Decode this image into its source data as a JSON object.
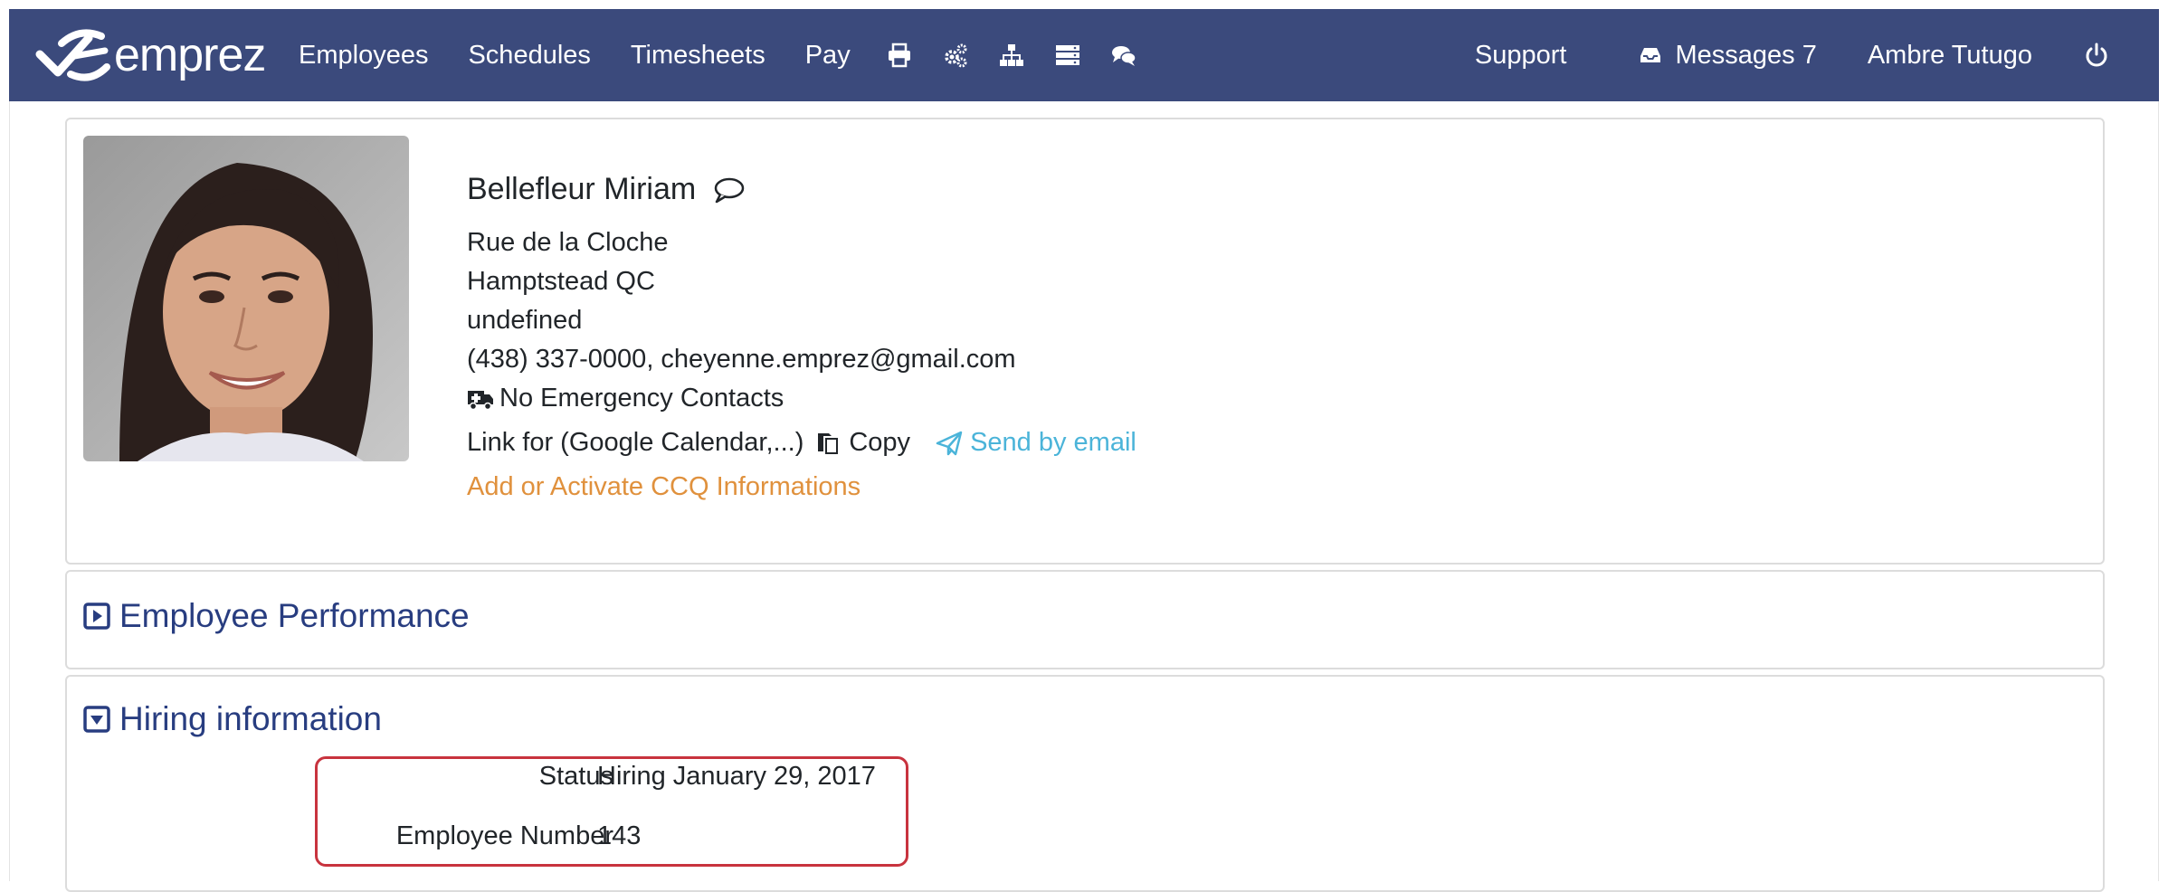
{
  "navbar": {
    "brand_name": "emprez",
    "links": [
      "Employees",
      "Schedules",
      "Timesheets",
      "Pay"
    ],
    "icons": [
      "print-icon",
      "settings-gears-icon",
      "org-chart-icon",
      "server-list-icon",
      "chat-icon"
    ],
    "support_label": "Support",
    "messages_label": "Messages 7",
    "user_name": "Ambre Tutugo",
    "bg_color": "#3b4a7c"
  },
  "profile": {
    "name": "Bellefleur Miriam",
    "address_line1": "Rue de la Cloche",
    "address_line2": "Hamptstead QC",
    "address_line3": "undefined",
    "contact": "(438) 337-0000, cheyenne.emprez@gmail.com",
    "emergency": "No Emergency Contacts",
    "calendar_link_label": "Link for (Google Calendar,...)",
    "copy_label": "Copy",
    "send_email_label": "Send by email",
    "ccq_label": "Add or Activate CCQ Informations"
  },
  "sections": {
    "performance_title": "Employee Performance",
    "hiring_title": "Hiring information"
  },
  "hiring": {
    "status_label": "Status",
    "status_value": "Hiring January 29, 2017",
    "employee_number_label": "Employee Number",
    "employee_number_value": "143"
  },
  "colors": {
    "section_title": "#283d80",
    "link_blue": "#4bb4d9",
    "link_orange": "#e0913d",
    "highlight_red": "#c8333e"
  }
}
